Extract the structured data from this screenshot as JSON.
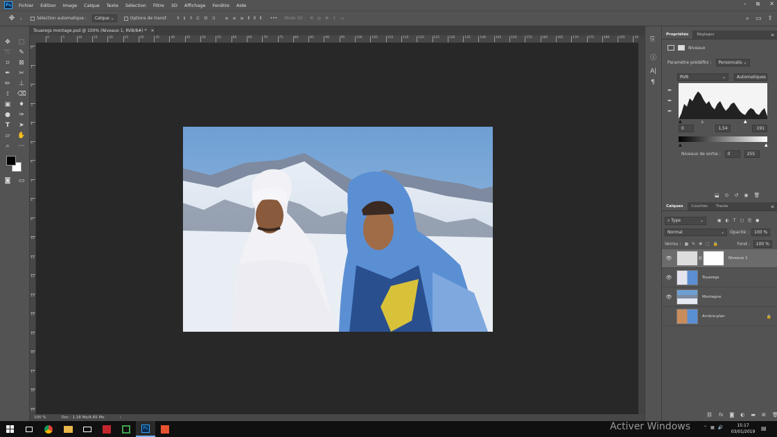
{
  "app": {
    "logo": "Ps"
  },
  "menu": [
    "Fichier",
    "Edition",
    "Image",
    "Calque",
    "Texte",
    "Sélection",
    "Filtre",
    "3D",
    "Affichage",
    "Fenêtre",
    "Aide"
  ],
  "window_controls": {
    "minimize": "–",
    "restore": "⧉",
    "close": "✕"
  },
  "options_bar": {
    "auto_select_label": "Sélection automatique :",
    "auto_select_value": "Calque",
    "transform_options_label": "Options de transf.",
    "mode_3d_label": "Mode 3D :",
    "more_label": "•••"
  },
  "document": {
    "tab_title": "Touaregs montage.psd @ 100% (Niveaux 1, RVB/8#) *",
    "tab_close": "×",
    "zoom": "100 %",
    "doc_size": "Doc : 1,18 Mo/4,65 Mo",
    "ruler_h_ticks": [
      "0",
      "5",
      "10",
      "15",
      "20",
      "25",
      "30",
      "35",
      "40",
      "45",
      "50",
      "55",
      "60",
      "65",
      "70",
      "75",
      "80",
      "85",
      "90",
      "95",
      "100",
      "105",
      "110",
      "115",
      "120",
      "125",
      "130",
      "135",
      "140",
      "145",
      "150",
      "155",
      "160",
      "165",
      "170",
      "175",
      "180",
      "185",
      "190",
      "195"
    ],
    "ruler_v_ticks": [
      "0",
      "1",
      "2",
      "3",
      "4",
      "5",
      "6",
      "7",
      "8",
      "9",
      "10",
      "11",
      "12",
      "13",
      "14",
      "15",
      "16",
      "17",
      "18",
      "19"
    ]
  },
  "properties": {
    "tabs": [
      "Propriétés",
      "Réglages"
    ],
    "adjustment_name": "Niveaux",
    "preset_label": "Paramètre prédéfini :",
    "preset_value": "Personnalis",
    "channel": "RVB",
    "auto_button": "Automatiques",
    "input_black": "0",
    "input_gamma": "1,54",
    "input_white": "191",
    "output_label": "Niveaux de sortie :",
    "output_black": "0",
    "output_white": "255"
  },
  "layers_panel": {
    "tabs": [
      "Calques",
      "Couches",
      "Tracés"
    ],
    "filter_type": "Type",
    "blend_mode": "Normal",
    "opacity_label": "Opacité :",
    "opacity_value": "100 %",
    "lock_label": "Verrou :",
    "fill_label": "Fond :",
    "fill_value": "100 %",
    "layers": [
      {
        "name": "Niveaux 1",
        "visible": true,
        "selected": true
      },
      {
        "name": "Touaregs",
        "visible": true,
        "selected": false
      },
      {
        "name": "Montagne",
        "visible": true,
        "selected": false
      },
      {
        "name": "Arrière-plan",
        "visible": false,
        "selected": false,
        "locked": true
      }
    ]
  },
  "taskbar": {
    "watermark": "Activer Windows",
    "time": "15:17",
    "date": "03/01/2019"
  },
  "colors": {
    "ui_bg": "#535353",
    "canvas_bg": "#282828",
    "ps_blue": "#31a8ff",
    "foreground": "#000000",
    "background": "#ffffff"
  }
}
